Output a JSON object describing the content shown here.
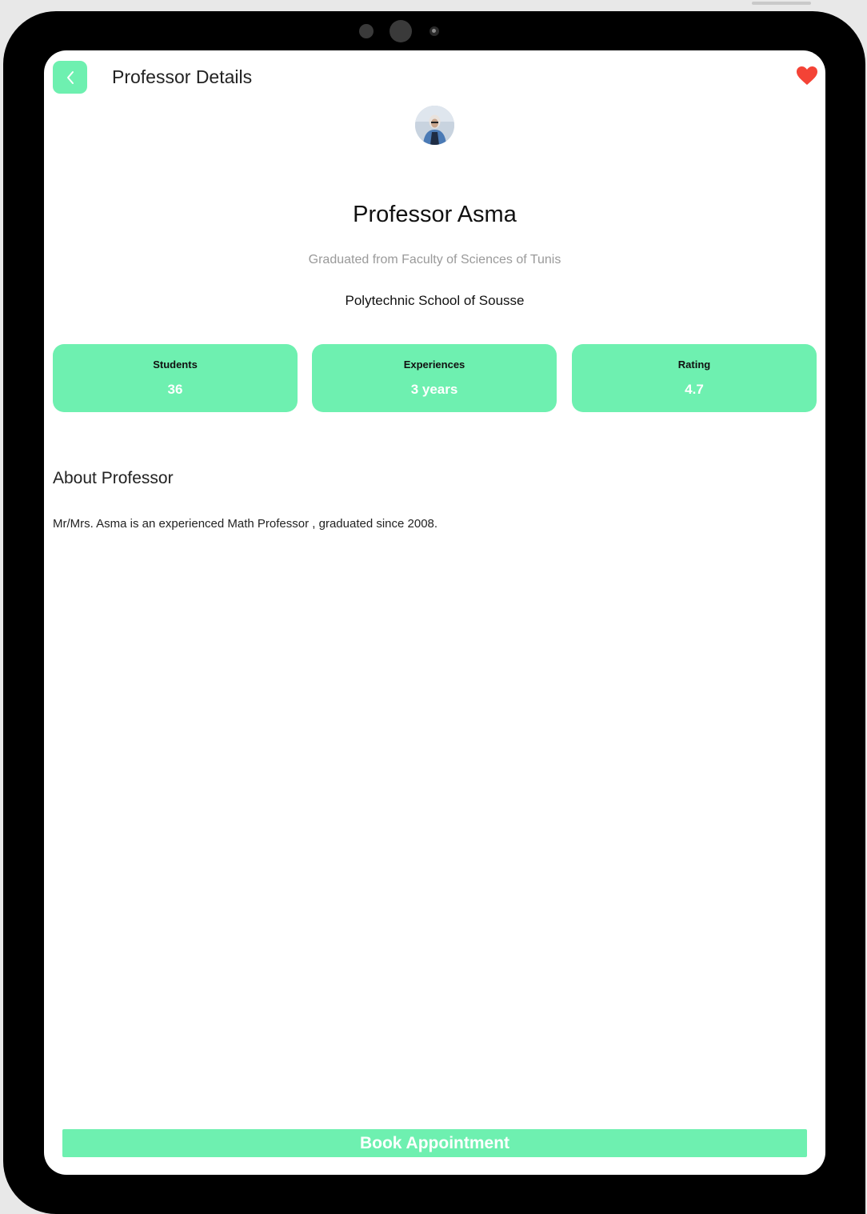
{
  "header": {
    "title": "Professor Details",
    "back_icon": "chevron-left-icon",
    "favorite_icon": "heart-icon",
    "favorite_color": "#f44336"
  },
  "profile": {
    "name": "Professor Asma",
    "graduation": "Graduated from Faculty of Sciences of Tunis",
    "school": "Polytechnic School of Sousse"
  },
  "stats": [
    {
      "label": "Students",
      "value": "36"
    },
    {
      "label": "Experiences",
      "value": "3 years"
    },
    {
      "label": "Rating",
      "value": "4.7"
    }
  ],
  "about": {
    "title": "About Professor",
    "text": "Mr/Mrs. Asma is an experienced Math Professor , graduated since 2008."
  },
  "actions": {
    "book_label": "Book Appointment"
  },
  "theme": {
    "accent": "#6ef0b0",
    "text": "#111111",
    "muted_text": "#9a9a9a"
  }
}
